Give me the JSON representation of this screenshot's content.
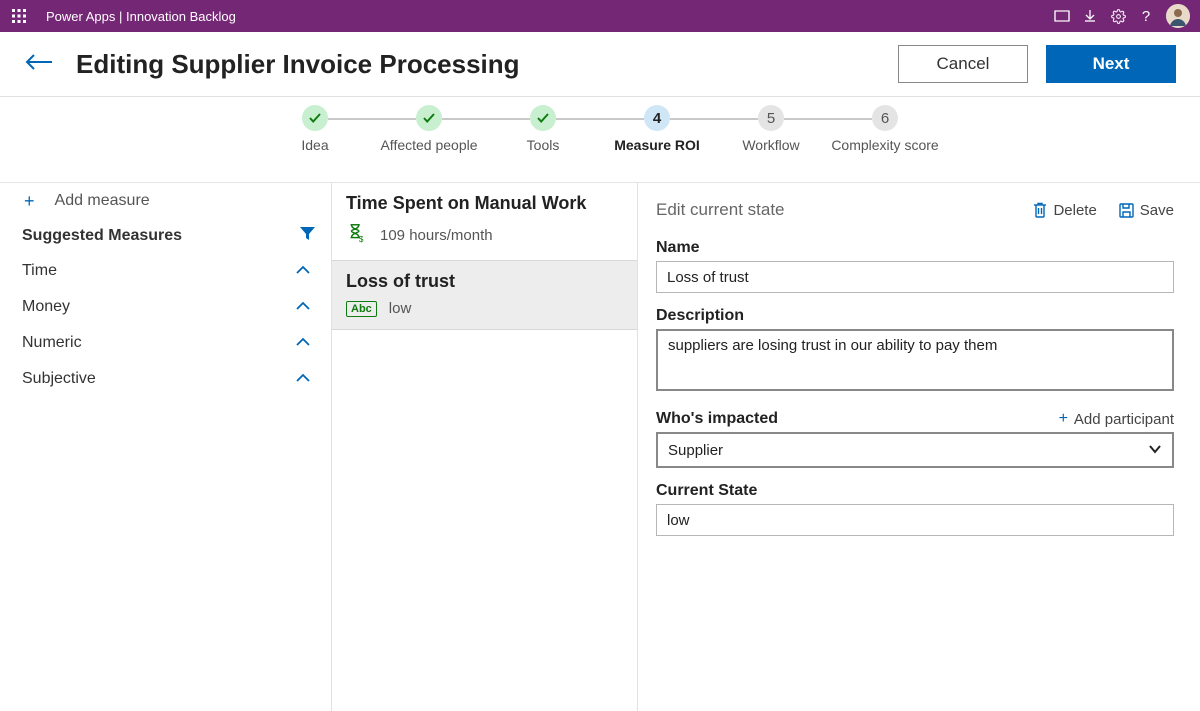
{
  "topbar": {
    "app": "Power Apps",
    "separator": " | ",
    "page": "Innovation Backlog"
  },
  "header": {
    "title": "Editing Supplier Invoice Processing",
    "cancel": "Cancel",
    "next": "Next"
  },
  "stepper": {
    "steps": [
      {
        "label": "Idea",
        "state": "done"
      },
      {
        "label": "Affected people",
        "state": "done"
      },
      {
        "label": "Tools",
        "state": "done"
      },
      {
        "label": "Measure ROI",
        "state": "active",
        "num": "4"
      },
      {
        "label": "Workflow",
        "state": "todo",
        "num": "5"
      },
      {
        "label": "Complexity score",
        "state": "todo",
        "num": "6"
      }
    ]
  },
  "sidebar": {
    "add": "Add measure",
    "suggested": "Suggested Measures",
    "cats": [
      "Time",
      "Money",
      "Numeric",
      "Subjective"
    ]
  },
  "cards": {
    "a": {
      "title": "Time Spent on Manual Work",
      "value": "109 hours/month"
    },
    "b": {
      "title": "Loss of trust",
      "chip": "Abc",
      "value": "low"
    }
  },
  "form": {
    "heading": "Edit current state",
    "delete": "Delete",
    "save": "Save",
    "name_label": "Name",
    "name_value": "Loss of trust",
    "desc_label": "Description",
    "desc_value": "suppliers are losing trust in our ability to pay them",
    "who_label": "Who's impacted",
    "add_participant": "Add participant",
    "who_value": "Supplier",
    "state_label": "Current State",
    "state_value": "low"
  }
}
